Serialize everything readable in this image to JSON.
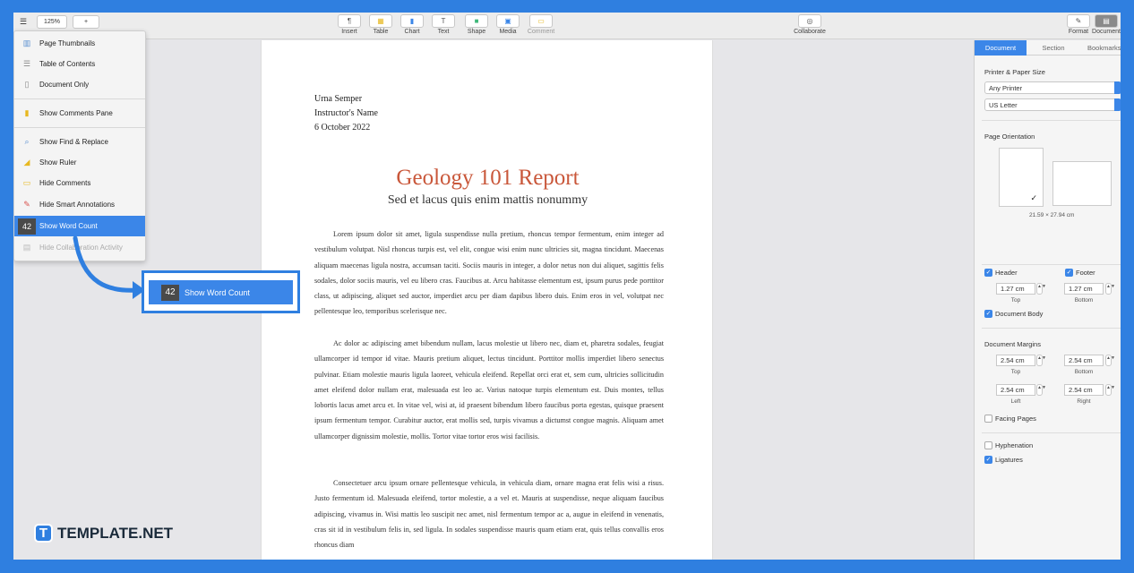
{
  "toolbar": {
    "zoom": "125%",
    "tools": [
      {
        "label": "Insert",
        "icon": "paragraph-icon",
        "glyph": "¶"
      },
      {
        "label": "Table",
        "icon": "table-icon",
        "glyph": "▦"
      },
      {
        "label": "Chart",
        "icon": "chart-icon",
        "glyph": "▮"
      },
      {
        "label": "Text",
        "icon": "text-icon",
        "glyph": "T"
      },
      {
        "label": "Shape",
        "icon": "shape-icon",
        "glyph": "■"
      },
      {
        "label": "Media",
        "icon": "media-icon",
        "glyph": "▣"
      },
      {
        "label": "Comment",
        "icon": "comment-icon",
        "glyph": "▭"
      }
    ],
    "collaborate": "Collaborate",
    "format": "Format",
    "document": "Document"
  },
  "view_menu": {
    "items": [
      {
        "label": "Page Thumbnails",
        "icon": "page-thumbnails-icon"
      },
      {
        "label": "Table of Contents",
        "icon": "table-of-contents-icon"
      },
      {
        "label": "Document Only",
        "icon": "document-only-icon"
      },
      {
        "label": "Show Comments Pane",
        "icon": "comments-pane-icon"
      },
      {
        "label": "Show Find & Replace",
        "icon": "find-icon"
      },
      {
        "label": "Show Ruler",
        "icon": "ruler-icon"
      },
      {
        "label": "Hide Comments",
        "icon": "comments-icon"
      },
      {
        "label": "Hide Smart Annotations",
        "icon": "annotations-icon"
      },
      {
        "label": "Show Word Count",
        "icon": "word-count-icon",
        "badge": "42"
      },
      {
        "label": "Hide Collaboration Activity",
        "icon": "collaboration-icon"
      }
    ]
  },
  "document": {
    "author": "Urna Semper",
    "instructor": "Instructor's Name",
    "date": "6 October 2022",
    "title": "Geology 101 Report",
    "subtitle": "Sed et lacus quis enim mattis nonummy",
    "paragraphs": [
      "Lorem ipsum dolor sit amet, ligula suspendisse nulla pretium, rhoncus tempor fermentum, enim integer ad vestibulum volutpat. Nisl rhoncus turpis est, vel elit, congue wisi enim nunc ultricies sit, magna tincidunt. Maecenas aliquam maecenas ligula nostra, accumsan taciti. Sociis mauris in integer, a dolor netus non dui aliquet, sagittis felis sodales, dolor sociis mauris, vel eu libero cras. Faucibus at. Arcu habitasse elementum est, ipsum purus pede porttitor class, ut adipiscing, aliquet sed auctor, imperdiet arcu per diam dapibus libero duis. Enim eros in vel, volutpat nec pellentesque leo, temporibus scelerisque nec.",
      "Ac dolor ac adipiscing amet bibendum nullam, lacus molestie ut libero nec, diam et, pharetra sodales, feugiat ullamcorper id tempor id vitae. Mauris pretium aliquet, lectus tincidunt. Porttitor mollis imperdiet libero senectus pulvinar. Etiam molestie mauris ligula laoreet, vehicula eleifend. Repellat orci erat et, sem cum, ultricies sollicitudin amet eleifend dolor nullam erat, malesuada est leo ac. Varius natoque turpis elementum est. Duis montes, tellus lobortis lacus amet arcu et. In vitae vel, wisi at, id praesent bibendum libero faucibus porta egestas, quisque praesent ipsum fermentum tempor. Curabitur auctor, erat mollis sed, turpis vivamus a dictumst congue magnis. Aliquam amet ullamcorper dignissim molestie, mollis. Tortor vitae tortor eros wisi facilisis.",
      "Consectetuer arcu ipsum ornare pellentesque vehicula, in vehicula diam, ornare magna erat felis wisi a risus. Justo fermentum id. Malesuada eleifend, tortor molestie, a a vel et. Mauris at suspendisse, neque aliquam faucibus adipiscing, vivamus in. Wisi mattis leo suscipit nec amet, nisl fermentum tempor ac a, augue in eleifend in venenatis, cras sit id in vestibulum felis in, sed ligula. In sodales suspendisse mauris quam etiam erat, quis tellus convallis eros rhoncus diam"
    ]
  },
  "panel": {
    "tabs": [
      "Document",
      "Section",
      "Bookmarks"
    ],
    "printer_paper_label": "Printer & Paper Size",
    "printer": "Any Printer",
    "paper": "US Letter",
    "orientation_label": "Page Orientation",
    "paper_dims": "21.59 × 27.94 cm",
    "header_label": "Header",
    "footer_label": "Footer",
    "header_value": "1.27 cm",
    "footer_value": "1.27 cm",
    "top_label": "Top",
    "bottom_label": "Bottom",
    "document_body_label": "Document Body",
    "margins_label": "Document Margins",
    "margin_top": "2.54 cm",
    "margin_bottom": "2.54 cm",
    "margin_left": "2.54 cm",
    "margin_right": "2.54 cm",
    "left_label": "Left",
    "right_label": "Right",
    "facing_pages_label": "Facing Pages",
    "hyphenation_label": "Hyphenation",
    "ligatures_label": "Ligatures"
  },
  "callout": {
    "badge": "42",
    "label": "Show Word Count"
  },
  "branding": {
    "mark": "T",
    "name": "TEMPLATE.NET"
  },
  "colors": {
    "accent": "#2f7fe0",
    "selection": "#3b86e8",
    "title": "#c9573a"
  }
}
